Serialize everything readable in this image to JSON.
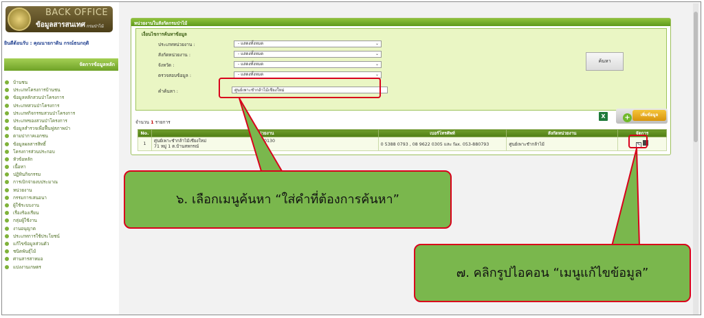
{
  "logo": {
    "title": "BACK OFFICE",
    "subtitle": "ข้อมูลสารสนเทศ",
    "org": "กรมป่าไม้"
  },
  "welcome": "ยินดีต้อนรับ : คุณนายกาดิน กรณ์ธนกฤติ",
  "sidebar": {
    "header": "จัดการข้อมูลหลัก",
    "items": [
      "บ้านชน",
      "ประเภทโครงการบ้านชน",
      "ข้อมูลหลักสวนป่าโครงการ",
      "ประเภทสวนป่าโครงการ",
      "ประเภทกิจกรรมสวนป่าโครงการ",
      "ประเภทของสวนป่าโครงการ",
      "ข้อมูลสำรวจเพื่อฟื้นฟูสภาพป่า",
      "ตามปากาคเอกชน",
      "ข้อมูลผลสารสิทธิ์",
      "โครงการส่วนประกอบ",
      "หัวข้อหลัก",
      "เนื้อหา",
      "ปฏิทินกิจกรรม",
      "การเบิกจ่ายงบประมาณ",
      "หน่วยงาน",
      "กรรมการเสนอนา",
      "ผู้ใช้ระบบงาน",
      "เรื่องร้องเรียน",
      "กลุ่มผู้ใช้งาน",
      "งานอนุญาต",
      "ประเภทการใช้ประโยชน์",
      "แก้ไขข้อมูลส่วนตัว",
      "ชนิดพันธุ์ไม้",
      "ศานสารสาหมอ",
      "แบ่งงานเกษตร"
    ]
  },
  "panel": {
    "title": "หน่วยงานในสังกัดกรมป่าไม้",
    "search_heading": "เงื่อนไขการค้นหาข้อมูล",
    "filters": [
      {
        "label": "ประเภทหน่วยงาน :",
        "value": "- แสดงทั้งหมด"
      },
      {
        "label": "สังกัดหน่วยงาน :",
        "value": "- แสดงทั้งหมด"
      },
      {
        "label": "จังหวัด :",
        "value": "- แสดงทั้งหมด"
      },
      {
        "label": "ตรวจสอบข้อมูล :",
        "value": "- แสดงทั้งหมด"
      }
    ],
    "keyword_label": "คำค้นหา :",
    "keyword_value": "ศูนย์เพาะชำกล้าไม้เชียงใหม่",
    "search_button": "ค้นหา",
    "count_prefix": "จำนวน",
    "count_value": "1",
    "count_suffix": "รายการ",
    "excel_icon": "X",
    "add_button": "เพิ่มข้อมูล",
    "columns": [
      "No.",
      "หน่วยงาน",
      "เบอร์โทรศัพท์",
      "สังกัดหน่วยงาน",
      "จัดการ"
    ],
    "rows": [
      {
        "no": "1",
        "unit_line1": "ศูนย์เพาะชำกล้าไม้เชียงใหม่",
        "unit_line2": "71 หมู่ 1 ต.บ้านสหกรณ์",
        "unit_tail": "0130",
        "phone": "0 5388 0793 , 08 9622 0305 และ fax. 053-880793",
        "dept": "ศูนย์เพาะชำกล้าไม้"
      }
    ]
  },
  "callouts": {
    "step6": "๖. เลือกเมนูค้นหา “ใส่คำที่ต้องการค้นหา”",
    "step7": "๗. คลิกรูปไอคอน “เมนูแก้ไขข้อมูล”"
  }
}
